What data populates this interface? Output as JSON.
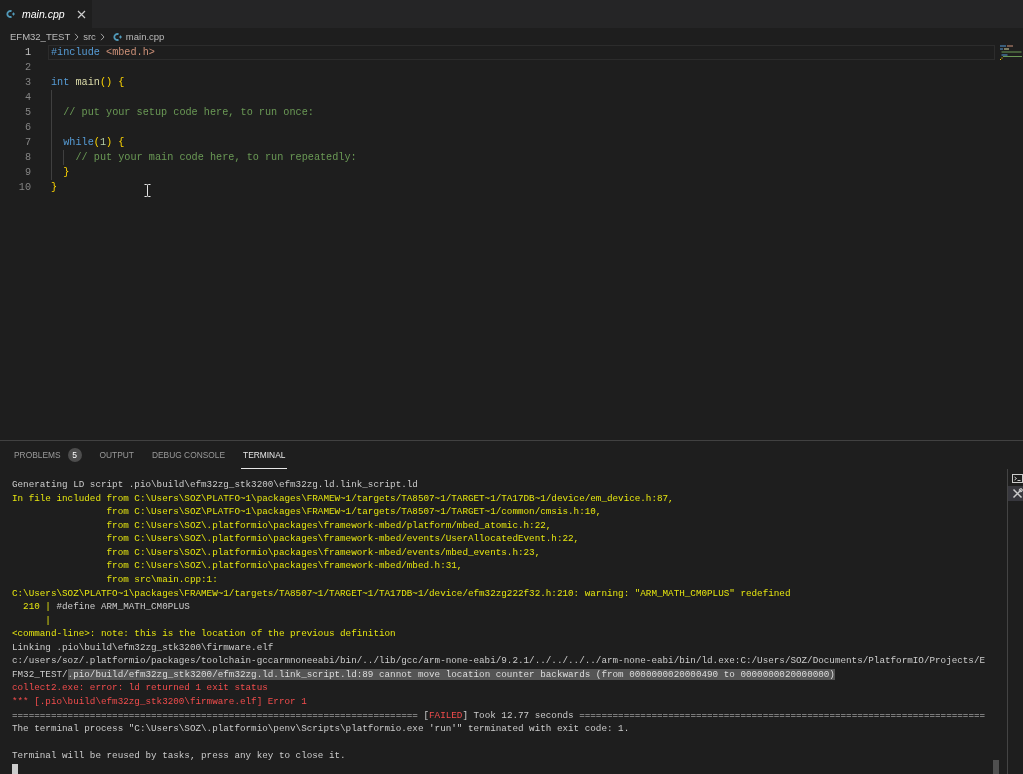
{
  "editor_tabs": [
    {
      "label": "main.cpp",
      "selected": true,
      "preview": true
    }
  ],
  "breadcrumb": [
    {
      "label": "EFM32_TEST",
      "kind": "folder"
    },
    {
      "label": "src",
      "kind": "folder"
    },
    {
      "label": "main.cpp",
      "kind": "file"
    }
  ],
  "editor": {
    "lines": [
      {
        "number": "1",
        "current": true,
        "tokens": [
          {
            "kind": "keyword",
            "text": "#include "
          },
          {
            "kind": "string",
            "text": "<mbed.h>"
          }
        ]
      },
      {
        "number": "2",
        "current": false
      },
      {
        "number": "3",
        "current": false,
        "tokens": [
          {
            "kind": "keyword",
            "text": "int "
          },
          {
            "kind": "function",
            "text": "main"
          },
          {
            "kind": "bracket",
            "text": "()"
          },
          {
            "kind": "bracket",
            "text": " {"
          }
        ]
      },
      {
        "number": "4",
        "current": false
      },
      {
        "number": "5",
        "current": false,
        "tokens": [
          {
            "kind": "comment",
            "text": "  // put your setup code here, to run once:"
          }
        ]
      },
      {
        "number": "6",
        "current": false
      },
      {
        "number": "7",
        "current": false,
        "tokens": [
          {
            "kind": "keyword",
            "text": "  while"
          },
          {
            "kind": "bracket",
            "text": "("
          },
          {
            "kind": "number",
            "text": "1"
          },
          {
            "kind": "bracket",
            "text": ")"
          },
          {
            "kind": "bracket",
            "text": " {"
          }
        ]
      },
      {
        "number": "8",
        "current": false,
        "tokens": [
          {
            "kind": "comment",
            "text": "    // put your main code here, to run repeatedly:"
          }
        ]
      },
      {
        "number": "9",
        "current": false,
        "tokens": [
          {
            "kind": "bracket",
            "text": "  }"
          }
        ]
      },
      {
        "number": "10",
        "current": false,
        "tokens": [
          {
            "kind": "bracket",
            "text": "}"
          }
        ]
      }
    ]
  },
  "panel": {
    "tabs": [
      {
        "label": "PROBLEMS",
        "badge": "5",
        "selected": false
      },
      {
        "label": "OUTPUT",
        "selected": false
      },
      {
        "label": "DEBUG CONSOLE",
        "selected": false
      },
      {
        "label": "TERMINAL",
        "selected": true
      }
    ],
    "terminal": {
      "lines": [
        {
          "kind": "text",
          "spans": [
            {
              "kind": "plain",
              "text": "Generating LD script .pio\\build\\efm32zg_stk3200\\efm32zg.ld.link_script.ld"
            }
          ]
        },
        {
          "kind": "text",
          "spans": [
            {
              "kind": "warning",
              "text": "In file included from C:\\Users\\SOZ\\PLATFO~1\\packages\\FRAMEW~1/targets/TA8507~1/TARGET~1/TA17DB~1/device/em_device.h:87,"
            }
          ]
        },
        {
          "kind": "text",
          "spans": [
            {
              "kind": "warning",
              "text": "                 from C:\\Users\\SOZ\\PLATFO~1\\packages\\FRAMEW~1/targets/TA8507~1/TARGET~1/common/cmsis.h:10,"
            }
          ]
        },
        {
          "kind": "text",
          "spans": [
            {
              "kind": "warning",
              "text": "                 from C:\\Users\\SOZ\\.platformio\\packages\\framework-mbed/platform/mbed_atomic.h:22,"
            }
          ]
        },
        {
          "kind": "text",
          "spans": [
            {
              "kind": "warning",
              "text": "                 from C:\\Users\\SOZ\\.platformio\\packages\\framework-mbed/events/UserAllocatedEvent.h:22,"
            }
          ]
        },
        {
          "kind": "text",
          "spans": [
            {
              "kind": "warning",
              "text": "                 from C:\\Users\\SOZ\\.platformio\\packages\\framework-mbed/events/mbed_events.h:23,"
            }
          ]
        },
        {
          "kind": "text",
          "spans": [
            {
              "kind": "warning",
              "text": "                 from C:\\Users\\SOZ\\.platformio\\packages\\framework-mbed/mbed.h:31,"
            }
          ]
        },
        {
          "kind": "text",
          "spans": [
            {
              "kind": "warning",
              "text": "                 from src\\main.cpp:1:"
            }
          ]
        },
        {
          "kind": "text",
          "spans": [
            {
              "kind": "warning",
              "text": "C:\\Users\\SOZ\\PLATFO~1\\packages\\FRAMEW~1/targets/TA8507~1/TARGET~1/TA17DB~1/device/efm32zg222f32.h:210: warning: \"ARM_MATH_CM0PLUS\" redefined"
            }
          ]
        },
        {
          "kind": "text",
          "spans": [
            {
              "kind": "warning",
              "text": "  210 | "
            },
            {
              "kind": "plain",
              "text": "#define ARM_MATH_CM0PLUS"
            }
          ]
        },
        {
          "kind": "text",
          "spans": [
            {
              "kind": "warning",
              "text": "      |"
            }
          ]
        },
        {
          "kind": "text",
          "spans": [
            {
              "kind": "warning",
              "text": "<command-line>: note: this is the location of the previous definition"
            }
          ]
        },
        {
          "kind": "text",
          "spans": [
            {
              "kind": "plain",
              "text": "Linking .pio\\build\\efm32zg_stk3200\\firmware.elf"
            }
          ]
        },
        {
          "kind": "text",
          "spans": [
            {
              "kind": "plain",
              "text": "c:/users/soz/.platformio/packages/toolchain-gccarmnoneeabi/bin/../lib/gcc/arm-none-eabi/9.2.1/../../../../arm-none-eabi/bin/ld.exe:C:/Users/SOZ/Documents/PlatformIO/Projects/E"
            }
          ]
        },
        {
          "kind": "text",
          "spans": [
            {
              "kind": "plain",
              "text": "FM32_TEST/"
            },
            {
              "kind": "highlighted",
              "text": ".pio/build/efm32zg_stk3200/efm32zg.ld.link_script.ld:89 cannot move location counter backwards (from 0000000020000490 to 0000000020000000)"
            }
          ]
        },
        {
          "kind": "text",
          "spans": [
            {
              "kind": "error",
              "text": "collect2.exe: error: ld returned 1 exit status"
            }
          ]
        },
        {
          "kind": "text",
          "spans": [
            {
              "kind": "error",
              "text": "*** [.pio\\build\\efm32zg_stk3200\\firmware.elf] Error 1"
            }
          ]
        },
        {
          "kind": "text",
          "spans": [
            {
              "kind": "plain",
              "text": "========================================================================= ["
            },
            {
              "kind": "error",
              "text": "FAILED"
            },
            {
              "kind": "plain",
              "text": "] Took 12.77 seconds ========================================================================="
            }
          ]
        },
        {
          "kind": "text",
          "spans": [
            {
              "kind": "plain",
              "text": "The terminal process \"C:\\Users\\SOZ\\.platformio\\penv\\Scripts\\platformio.exe 'run'\" terminated with exit code: 1."
            }
          ]
        },
        {
          "kind": "blank"
        },
        {
          "kind": "text",
          "spans": [
            {
              "kind": "plain",
              "text": "Terminal will be reused by tasks, press any key to close it."
            }
          ]
        },
        {
          "kind": "cursor"
        }
      ],
      "instances": [
        {
          "kind": "shell",
          "selected": false
        },
        {
          "kind": "task",
          "selected": true
        }
      ]
    }
  }
}
